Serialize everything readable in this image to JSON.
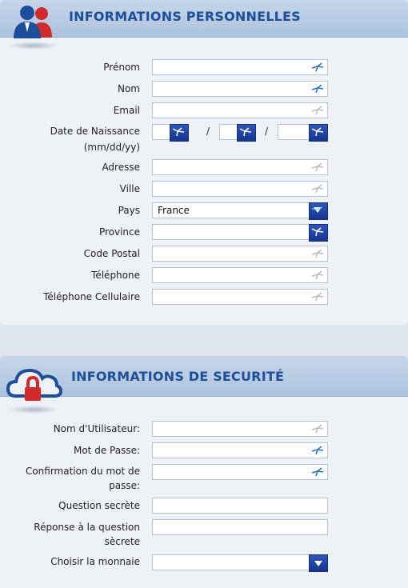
{
  "personal": {
    "title": "INFORMATIONS PERSONNELLES",
    "fields": {
      "prenom": {
        "label": "Prénom",
        "value": ""
      },
      "nom": {
        "label": "Nom",
        "value": ""
      },
      "email": {
        "label": "Email",
        "value": ""
      },
      "dob": {
        "label_line1": "Date de Naissance",
        "label_line2": "(mm/dd/yy)",
        "separator": "/"
      },
      "adresse": {
        "label": "Adresse",
        "value": ""
      },
      "ville": {
        "label": "Ville",
        "value": ""
      },
      "pays": {
        "label": "Pays",
        "value": "France"
      },
      "province": {
        "label": "Province",
        "value": ""
      },
      "code_postal": {
        "label": "Code Postal",
        "value": ""
      },
      "telephone": {
        "label": "Téléphone",
        "value": ""
      },
      "telephone_cellulaire": {
        "label": "Téléphone Cellulaire",
        "value": ""
      }
    }
  },
  "security": {
    "title": "INFORMATIONS DE SECURITÉ",
    "fields": {
      "username": {
        "label": "Nom d'Utilisateur:",
        "value": ""
      },
      "password": {
        "label": "Mot de Passe:",
        "value": ""
      },
      "password_confirm": {
        "label_line1": "Confirmation du mot de",
        "label_line2": "passe:",
        "value": ""
      },
      "secret_question": {
        "label": "Question secrète",
        "value": ""
      },
      "secret_answer": {
        "label_line1": "Réponse à la question",
        "label_line2": "sècrete",
        "value": ""
      },
      "currency": {
        "label": "Choisir la monnaie",
        "value": ""
      }
    }
  },
  "colors": {
    "accent": "#1d4e9a",
    "select_button": "#1e3f9f",
    "header_bg": "#bccde4",
    "panel_bg": "#eef1f5"
  },
  "icons": {
    "personal_header": "users-icon",
    "security_header": "cloud-lock-icon",
    "field_hint": "checkmark-arrow-icon"
  }
}
